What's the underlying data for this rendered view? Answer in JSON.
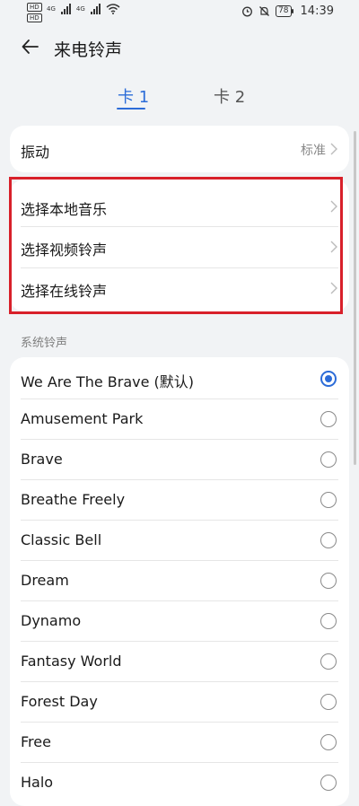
{
  "status_bar": {
    "hd1": "HD",
    "hd2": "HD",
    "net1": "4G",
    "net2": "4G",
    "battery": "78",
    "time": "14:39"
  },
  "header": {
    "title": "来电铃声"
  },
  "tabs": [
    {
      "label": "卡 1",
      "active": true
    },
    {
      "label": "卡 2",
      "active": false
    }
  ],
  "vibration": {
    "label": "振动",
    "value": "标准"
  },
  "options": [
    {
      "label": "选择本地音乐"
    },
    {
      "label": "选择视频铃声"
    },
    {
      "label": "选择在线铃声"
    }
  ],
  "section_title": "系统铃声",
  "ringtones": [
    {
      "label": "We Are The Brave (默认)",
      "selected": true
    },
    {
      "label": "Amusement Park",
      "selected": false
    },
    {
      "label": "Brave",
      "selected": false
    },
    {
      "label": "Breathe Freely",
      "selected": false
    },
    {
      "label": "Classic Bell",
      "selected": false
    },
    {
      "label": "Dream",
      "selected": false
    },
    {
      "label": "Dynamo",
      "selected": false
    },
    {
      "label": "Fantasy World",
      "selected": false
    },
    {
      "label": "Forest Day",
      "selected": false
    },
    {
      "label": "Free",
      "selected": false
    },
    {
      "label": "Halo",
      "selected": false
    }
  ],
  "colors": {
    "accent": "#2c6cd8",
    "highlight": "#d8202a",
    "background": "#f1f3f5"
  }
}
